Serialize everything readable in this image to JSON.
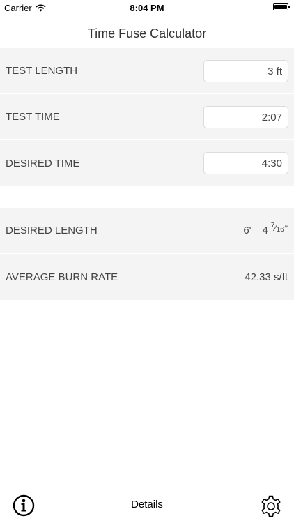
{
  "status_bar": {
    "carrier": "Carrier",
    "time": "8:04 PM"
  },
  "nav": {
    "title": "Time Fuse Calculator"
  },
  "inputs": [
    {
      "label": "TEST LENGTH",
      "value": "3 ft"
    },
    {
      "label": "TEST TIME",
      "value": "2:07"
    },
    {
      "label": "DESIRED TIME",
      "value": "4:30"
    }
  ],
  "results": {
    "desired_length": {
      "label": "DESIRED LENGTH",
      "feet": "6'",
      "inches": "4",
      "frac_num": "7",
      "frac_den": "16",
      "inch_mark": "\""
    },
    "average_burn_rate": {
      "label": "AVERAGE BURN RATE",
      "value": "42.33 s/ft"
    }
  },
  "toolbar": {
    "details_label": "Details",
    "info_icon": "info-circle-icon",
    "settings_icon": "gear-icon"
  }
}
